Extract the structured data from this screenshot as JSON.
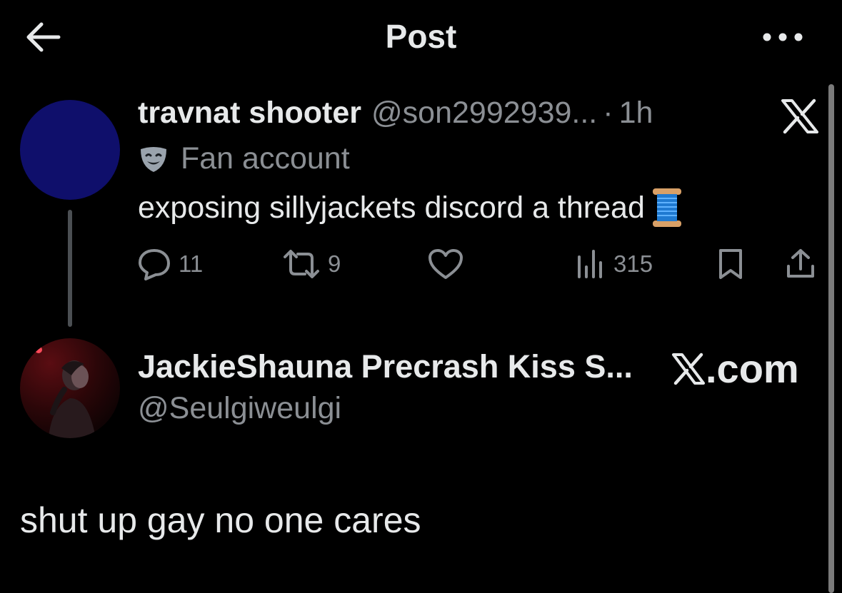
{
  "header": {
    "title": "Post",
    "back_icon": "arrow-left-icon",
    "more_icon": "more-horizontal-icon"
  },
  "parent_post": {
    "display_name": "travnat shooter",
    "handle": "@son2992939...",
    "separator": "·",
    "time": "1h",
    "label_icon": "theater-masks-icon",
    "label": "Fan account",
    "text": "exposing sillyjackets discord a thread",
    "text_emoji_icon": "spool-of-thread-icon",
    "avatar_color": "#0f0f6b",
    "brand_icon": "x-logo-icon",
    "actions": {
      "replies": "11",
      "reposts": "9",
      "likes": "",
      "views": "315"
    }
  },
  "reply_post": {
    "display_name": "JackieShauna Precrash Kiss S...",
    "handle": "@Seulgiweulgi",
    "brand_suffix": ".com",
    "text": "shut up gay no one cares"
  },
  "colors": {
    "background": "#000000",
    "primary_text": "#e7e9ea",
    "secondary_text": "#8b8f94",
    "thread_line": "#4b4f53"
  }
}
